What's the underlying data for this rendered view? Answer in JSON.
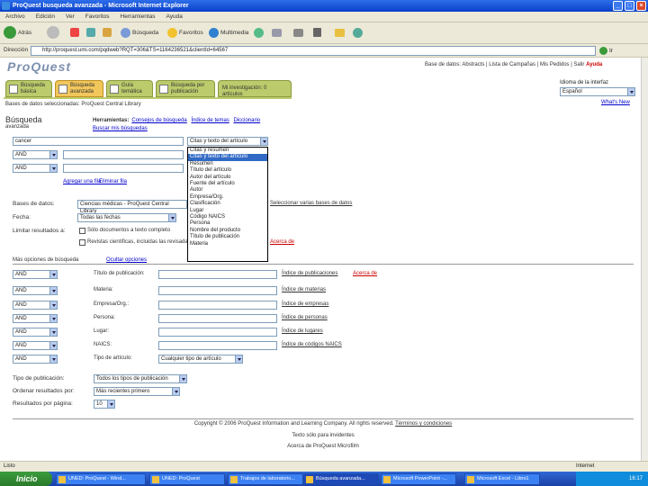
{
  "window": {
    "title": "ProQuest busqueda avanzada - Microsoft Internet Explorer"
  },
  "menu": [
    "Archivo",
    "Edición",
    "Ver",
    "Favoritos",
    "Herramientas",
    "Ayuda"
  ],
  "toolbar": {
    "back": "Atrás",
    "search": "Búsqueda",
    "favorites": "Favoritos",
    "multimedia": "Multimedia"
  },
  "address": {
    "label": "Dirección",
    "url": "http://proquest.umi.com/pqdweb?RQT=306&TS=1164236521&clientId=64567",
    "go": "Ir"
  },
  "header": {
    "logo": "ProQuest",
    "links": "Base de datos: Abstracts | Lista de Campañas | Mis Pedidos | Salir",
    "help": "Ayuda",
    "language_label": "Idioma de la interfaz",
    "language": "Español"
  },
  "tabs": [
    {
      "label": "Búsqueda básica"
    },
    {
      "label": "Búsqueda avanzada"
    },
    {
      "label": "Guía temática"
    },
    {
      "label": "Búsqueda por publicación"
    },
    {
      "label": "Mi investigación: 0 artículos"
    }
  ],
  "breadcrumb": "Bases de datos seleccionadas: ProQuest Central Library",
  "whats_new": "What's New",
  "search": {
    "title": "Búsqueda",
    "subtitle": "avanzada",
    "tools_label": "Herramientas:",
    "tools": [
      "Consejos de búsqueda",
      "Índice de temas",
      "Diccionario"
    ],
    "tools2": "Buscar mis búsquedas",
    "term1": "cancer",
    "field_select": "Citas y texto del artículo",
    "ops": [
      "AND",
      "AND",
      "AND"
    ],
    "add_row": "Agregar una fila",
    "remove_row": "Eliminar fila",
    "dropdown_options": [
      "Citas y resumen",
      "Citas y texto del artículo",
      "Resumen",
      "Título del artículo",
      "Autor del artículo",
      "Fuente del artículo",
      "Autor",
      "Empresa/Org.",
      "Clasificación",
      "Lugar",
      "Código NAICS",
      "Persona",
      "Nombre del producto",
      "Título de publicación",
      "Materia"
    ],
    "db_label": "Bases de datos:",
    "db_value": "Ciencias médicas - ProQuest Central Library",
    "db_link": "Seleccionar varias bases de datos",
    "date_label": "Fecha:",
    "date_value": "Todas las fechas",
    "limit_label": "Limitar resultados a:",
    "limit1": "Sólo documentos a texto completo",
    "limit2": "Revistas científicas, incluidas las revisadas por pares",
    "limit_link": "Acerca de"
  },
  "more_options": {
    "title": "Más opciones de búsqueda",
    "reduce": "Ocultar opciones",
    "rows": [
      {
        "op": "AND",
        "label": "Título de publicación:",
        "links": [
          "Índice de publicaciones",
          "Acerca de"
        ]
      },
      {
        "op": "AND",
        "label": "Materia:",
        "links": [
          "Índice de materias"
        ]
      },
      {
        "op": "AND",
        "label": "Empresa/Org.:",
        "links": [
          "Índice de empresas"
        ]
      },
      {
        "op": "AND",
        "label": "Persona:",
        "links": [
          "Índice de personas"
        ]
      },
      {
        "op": "AND",
        "label": "Lugar:",
        "links": [
          "Índice de lugares"
        ]
      },
      {
        "op": "AND",
        "label": "NAICS:",
        "links": [
          "Índice de códigos NAICS"
        ]
      },
      {
        "op": "AND",
        "label": "Tipo de artículo:",
        "select": "Cualquier tipo de artículo"
      }
    ],
    "pub_type_label": "Tipo de publicación:",
    "pub_type": "Todos los tipos de publicación",
    "sort_label": "Ordenar resultados por:",
    "sort": "Más recientes primero",
    "per_page_label": "Resultados por página:",
    "per_page": "10"
  },
  "footer": {
    "copyright": "Copyright © 2006 ProQuest Information and Learning Company. All rights reserved.",
    "terms": "Términos y condiciones",
    "line2": "Texto sólo para invidentes",
    "line3": "Acerca de ProQuest Microfilm"
  },
  "status": {
    "text": "Listo",
    "zone": "Internet"
  },
  "taskbar": {
    "start": "Inicio",
    "tasks": [
      "UNED: ProQuest - Wind...",
      "UNED: ProQuest",
      "Trabajos de laboratorio...",
      "Búsqueda avanzada...",
      "Microsoft PowerPoint -...",
      "Microsoft Excel - Libro1"
    ],
    "clock": "16:17"
  }
}
